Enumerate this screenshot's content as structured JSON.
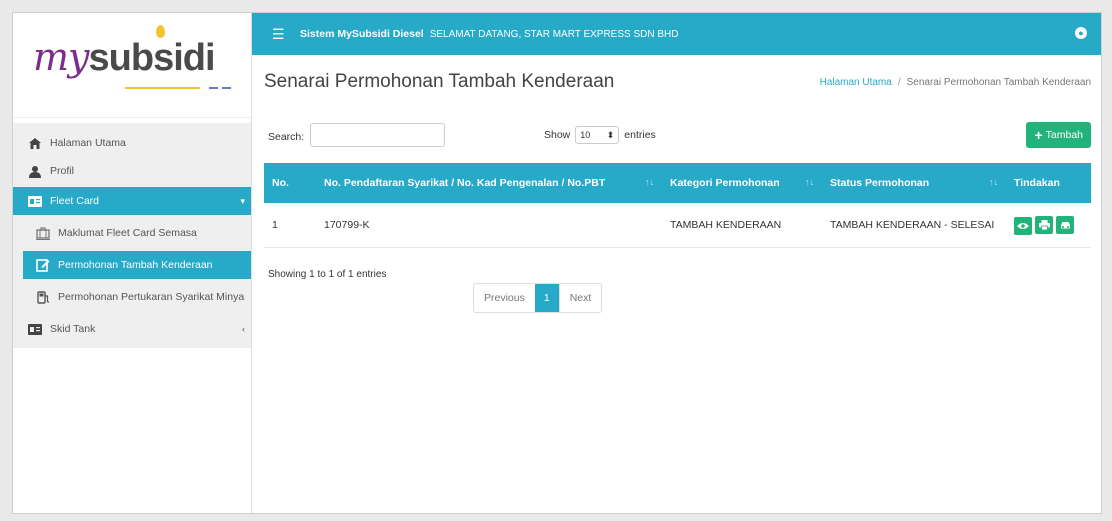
{
  "logo": {
    "prefix": "my",
    "suffix": "subsidi"
  },
  "sidebar": {
    "items": [
      {
        "label": "Halaman Utama",
        "icon": "home-icon"
      },
      {
        "label": "Profil",
        "icon": "user-icon"
      },
      {
        "label": "Fleet Card",
        "icon": "id-card-icon"
      },
      {
        "label": "Maklumat Fleet Card Semasa",
        "icon": "luggage-icon"
      },
      {
        "label": "Permohonan Tambah Kenderaan",
        "icon": "edit-icon"
      },
      {
        "label": "Permohonan Pertukaran Syarikat Minya",
        "icon": "gas-pump-icon"
      },
      {
        "label": "Skid Tank",
        "icon": "id-card-icon"
      }
    ]
  },
  "topbar": {
    "title": "Sistem MySubsidi Diesel",
    "welcome": "SELAMAT DATANG, STAR MART EXPRESS SDN BHD"
  },
  "page": {
    "title": "Senarai Permohonan Tambah Kenderaan",
    "breadcrumb_home": "Halaman Utama",
    "breadcrumb_sep": "/",
    "breadcrumb_current": "Senarai Permohonan Tambah Kenderaan"
  },
  "table_controls": {
    "search_label": "Search:",
    "search_value": "",
    "show_label": "Show",
    "entries_value": "10",
    "entries_label": "entries",
    "add_button": "Tambah"
  },
  "table": {
    "headers": [
      "No.",
      "No. Pendaftaran Syarikat / No. Kad Pengenalan / No.PBT",
      "Kategori Permohonan",
      "Status Permohonan",
      "Tindakan"
    ],
    "rows": [
      {
        "no": "1",
        "reg": "170799-K",
        "category": "TAMBAH KENDERAAN",
        "status": "TAMBAH KENDERAAN - SELESAI"
      }
    ]
  },
  "pagination": {
    "info": "Showing 1 to 1 of 1 entries",
    "previous": "Previous",
    "current": "1",
    "next": "Next"
  },
  "colors": {
    "primary": "#27a9c8",
    "success": "#21b37a"
  }
}
